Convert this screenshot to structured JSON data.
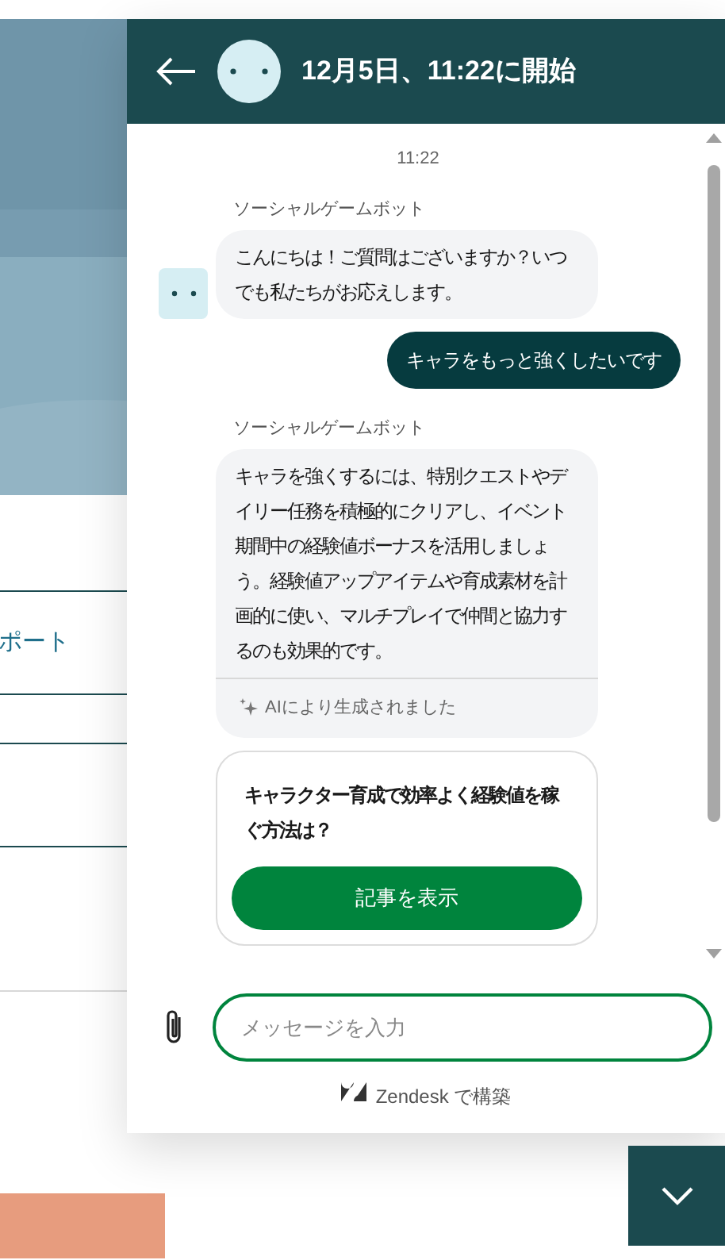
{
  "page": {
    "link_text": "ポート"
  },
  "widget": {
    "header": {
      "title": "12月5日、11:22に開始"
    },
    "messages": [
      {
        "kind": "timestamp",
        "text": "11:22"
      },
      {
        "kind": "bot",
        "sender": "ソーシャルゲームボット",
        "avatar": true,
        "text": "こんにちは！ご質問はございますか？いつでも私たちがお応えします。"
      },
      {
        "kind": "user",
        "text": "キャラをもっと強くしたいです"
      },
      {
        "kind": "bot",
        "sender": "ソーシャルゲームボット",
        "avatar": false,
        "text": "キャラを強くするには、特別クエストやデイリー任務を積極的にクリアし、イベント期間中の経験値ボーナスを活用しましょう。経験値アップアイテムや育成素材を計画的に使い、マルチプレイで仲間と協力するのも効果的です。",
        "footer": "AIにより生成されました"
      },
      {
        "kind": "article",
        "title": "キャラクター育成で効率よく経験値を稼ぐ方法は？",
        "button": "記事を表示"
      }
    ],
    "composer": {
      "placeholder": "メッセージを入力"
    },
    "footer": "Zendesk で構築"
  }
}
